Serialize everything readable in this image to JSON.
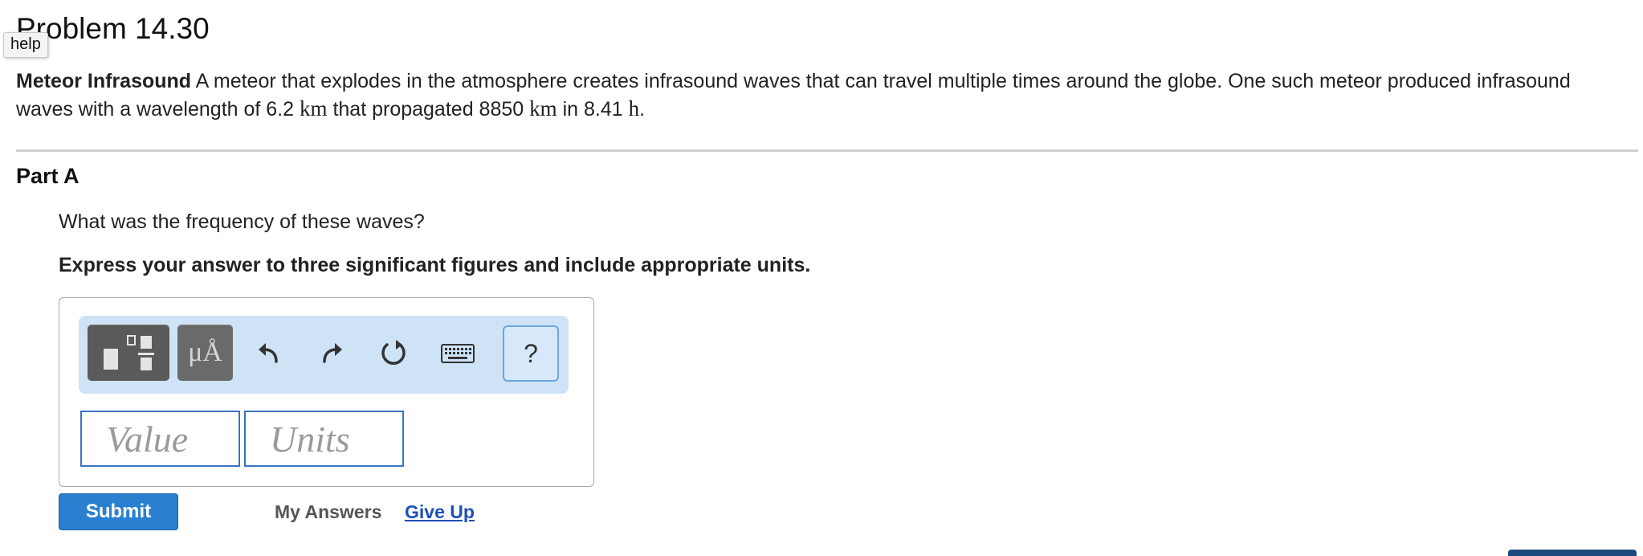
{
  "problem": {
    "title": "Problem 14.30",
    "help_label": "help"
  },
  "intro": {
    "lead": "Meteor Infrasound",
    "text_1": " A meteor that explodes in the atmosphere creates infrasound waves that can travel multiple times around the globe. One such meteor produced infrasound waves with a wavelength of 6.2 ",
    "unit_km_1": "km",
    "text_2": " that propagated 8850 ",
    "unit_km_2": "km",
    "text_3": " in 8.41 ",
    "unit_h": "h",
    "text_4": "."
  },
  "part_a": {
    "heading": "Part A",
    "question": "What was the frequency of these waves?",
    "instruction": "Express your answer to three significant figures and include appropriate units."
  },
  "toolbar": {
    "units_symbol": "μÅ",
    "help_symbol": "?"
  },
  "answer": {
    "value_placeholder": "Value",
    "units_placeholder": "Units"
  },
  "actions": {
    "submit_label": "Submit",
    "my_answers_label": "My Answers",
    "give_up_label": "Give Up"
  },
  "colors": {
    "toolbar_bg": "#cfe3f7",
    "submit_bg": "#2a80d0",
    "field_border": "#3a74c7",
    "link": "#1f4fb8"
  }
}
